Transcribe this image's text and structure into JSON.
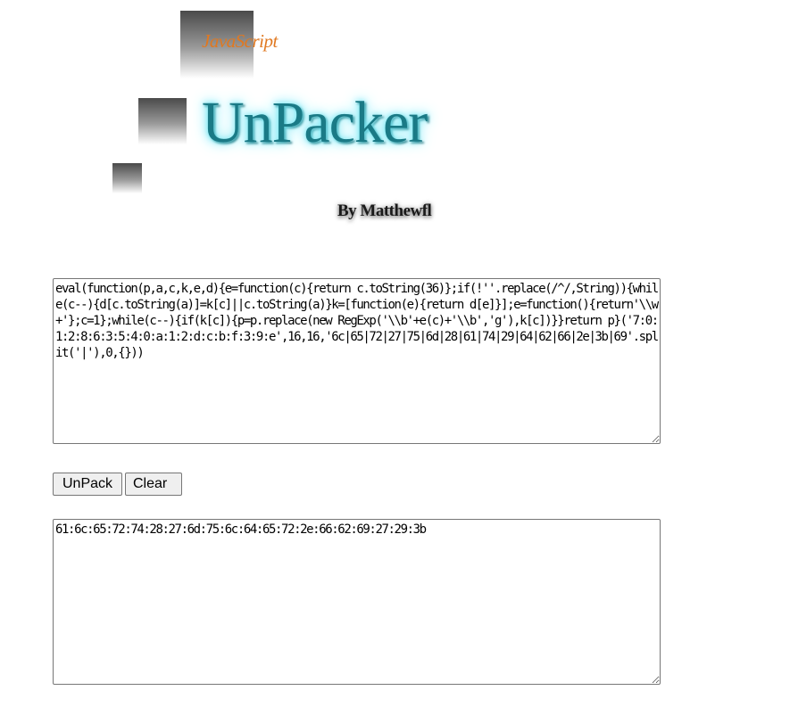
{
  "logo": {
    "subtitle": "JavaScript",
    "title": "UnPacker",
    "byline": "By Matthewfl"
  },
  "input": {
    "value": "eval(function(p,a,c,k,e,d){e=function(c){return c.toString(36)};if(!''.replace(/^/,String)){while(c--){d[c.toString(a)]=k[c]||c.toString(a)}k=[function(e){return d[e]}];e=function(){return'\\\\w+'};c=1};while(c--){if(k[c]){p=p.replace(new RegExp('\\\\b'+e(c)+'\\\\b','g'),k[c])}}return p}('7:0:1:2:8:6:3:5:4:0:a:1:2:d:c:b:f:3:9:e',16,16,'6c|65|72|27|75|6d|28|61|74|29|64|62|66|2e|3b|69'.split('|'),0,{}))"
  },
  "buttons": {
    "unpack": "UnPack",
    "clear": "Clear"
  },
  "output": {
    "value": "61:6c:65:72:74:28:27:6d:75:6c:64:65:72:2e:66:62:69:27:29:3b"
  }
}
